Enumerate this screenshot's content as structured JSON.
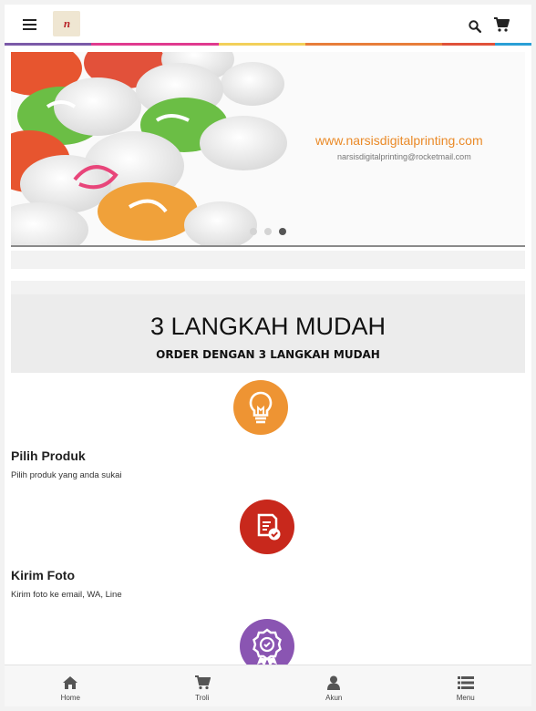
{
  "header": {
    "logo_text": "n",
    "stripe_colors": [
      "#7b5aa8",
      "#e03a8f",
      "#f2d05a",
      "#e87e3b",
      "#e0523a",
      "#2a9fd6"
    ]
  },
  "slider": {
    "url_text": "www.narsisdigitalprinting.com",
    "email_text": "narsisdigitalprinting@rocketmail.com",
    "active_slide": 3,
    "slide_count": 3
  },
  "steps": {
    "title": "3 LANGKAH MUDAH",
    "subtitle": "ORDER DENGAN 3 LANGKAH MUDAH",
    "items": [
      {
        "title": "Pilih Produk",
        "desc": "Pilih produk yang anda sukai",
        "color": "#ee9433",
        "icon": "lightbulb-icon"
      },
      {
        "title": "Kirim Foto",
        "desc": "Kirim foto ke email, WA, Line",
        "color": "#c8281c",
        "icon": "document-check-icon"
      },
      {
        "title": "",
        "desc": "",
        "color": "#8a55b2",
        "icon": "award-badge-icon"
      }
    ]
  },
  "bottom_nav": {
    "items": [
      {
        "label": "Home",
        "icon": "home-icon"
      },
      {
        "label": "Troli",
        "icon": "cart-icon"
      },
      {
        "label": "Akun",
        "icon": "user-icon"
      },
      {
        "label": "Menu",
        "icon": "list-icon"
      }
    ]
  }
}
